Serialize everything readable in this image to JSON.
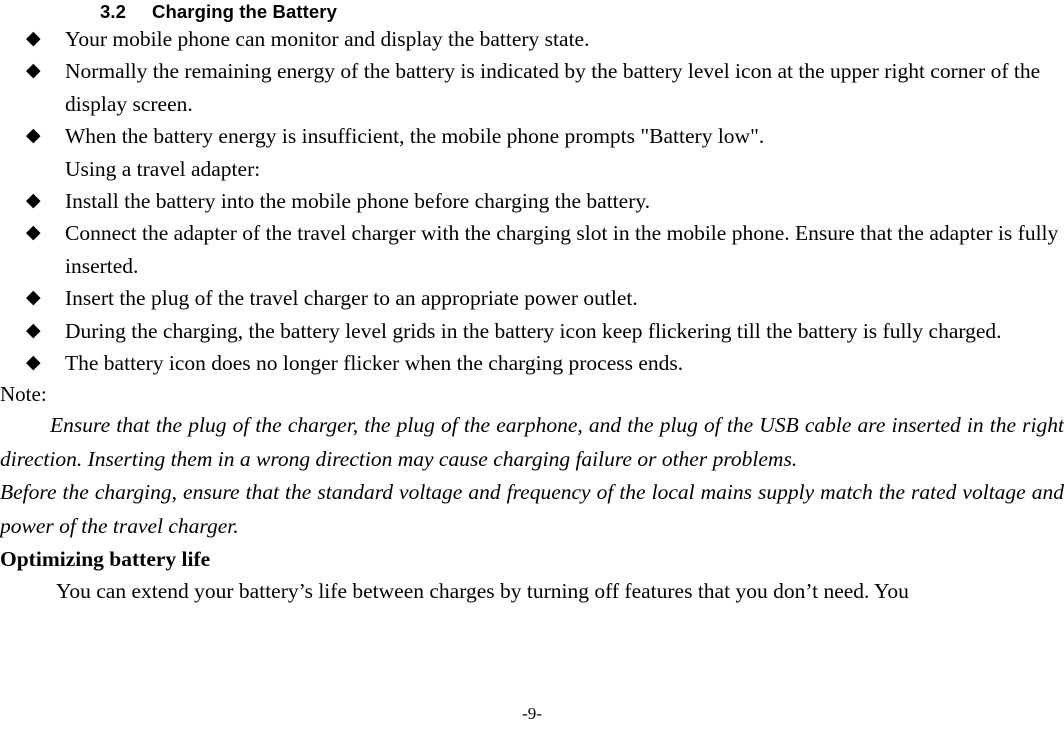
{
  "document": {
    "section_number": "3.2",
    "section_title": "Charging the Battery",
    "bullet_glyph": "◆",
    "bullets": [
      "Your mobile phone can monitor and display the battery state.",
      "Normally the remaining energy of the battery is indicated by the battery level icon at the upper right corner of the display screen.",
      "When the battery energy is insufficient, the mobile phone prompts \"Battery low\"."
    ],
    "sub_line": "Using a travel adapter:",
    "bullets_2": [
      "Install the battery into the mobile phone before charging the battery.",
      "Connect the adapter of the travel charger with the charging slot in the mobile phone. Ensure that the adapter is fully inserted.",
      "Insert the plug of the travel charger to an appropriate power outlet.",
      "During the charging, the battery level grids in the battery icon keep flickering till the battery is fully charged.",
      "The battery icon does no longer flicker when the charging process ends."
    ],
    "note_label": "Note:",
    "note_paragraphs": [
      "Ensure that the plug of the charger, the plug of the earphone, and the plug of the USB cable are inserted in the right direction. Inserting them in a wrong direction may cause charging failure or other problems.",
      "Before the charging, ensure that the standard voltage and frequency of the local mains supply match the rated voltage and power of the travel charger."
    ],
    "sub_heading": "Optimizing battery life",
    "body_paragraph": "You can extend your battery’s life between charges by turning off features that you don’t need. You",
    "page_number": "-9-",
    "text_color": "#000000",
    "background_color": "#ffffff"
  }
}
